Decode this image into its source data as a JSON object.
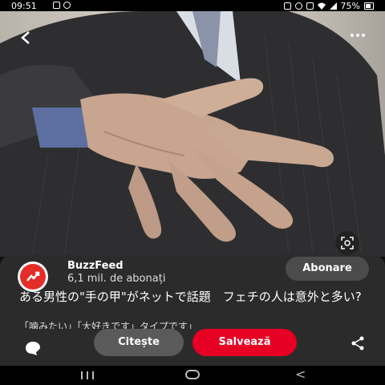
{
  "status_bar": {
    "time": "09:51",
    "battery": "75%",
    "left_icons": [
      "image-icon",
      "whatsapp-icon"
    ],
    "right_icons": [
      "sync-icon",
      "location-icon",
      "vibrate-icon",
      "wifi-icon",
      "signal-icon",
      "battery-icon"
    ]
  },
  "pin": {
    "image_alt": "hand-photo",
    "back_icon": "back-arrow-icon",
    "more_icon": "more-icon",
    "lens_icon": "visual-search-icon"
  },
  "channel": {
    "name": "BuzzFeed",
    "subscribers": "6,1 mil. de abonați",
    "subscribe_label": "Abonare"
  },
  "content": {
    "title": "ある男性の\"手の甲\"がネットで話題　フェチの人は意外と多い?",
    "snippet": "「噛みたい」「大好きです」タイプです」"
  },
  "actions": {
    "read_label": "Citește",
    "save_label": "Salvează",
    "comment_icon": "comment-icon",
    "share_icon": "share-icon"
  },
  "colors": {
    "save": "#e60023",
    "sheet": "#2b2b2b",
    "brand": "#e32d26"
  }
}
